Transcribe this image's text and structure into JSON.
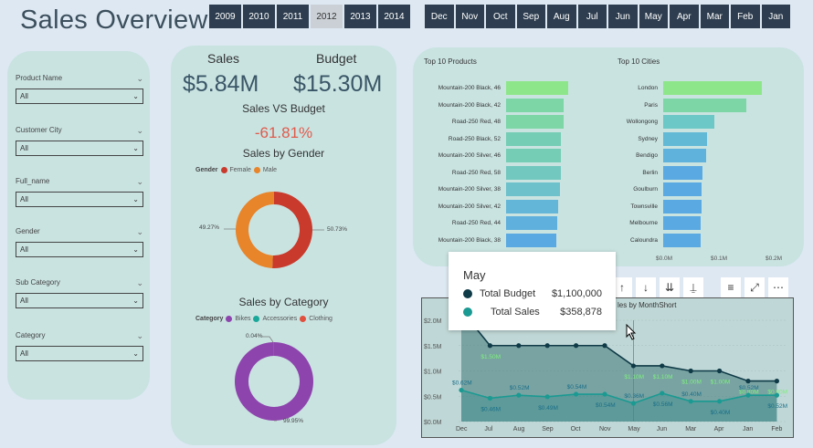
{
  "header": {
    "title": "Sales Overview"
  },
  "years": [
    "2009",
    "2010",
    "2011",
    "2012",
    "2013",
    "2014"
  ],
  "selected_year": "2012",
  "months": [
    "Dec",
    "Nov",
    "Oct",
    "Sep",
    "Aug",
    "Jul",
    "Jun",
    "May",
    "Apr",
    "Mar",
    "Feb",
    "Jan"
  ],
  "filters": [
    {
      "label": "Product Name",
      "value": "All"
    },
    {
      "label": "Customer City",
      "value": "All"
    },
    {
      "label": "Full_name",
      "value": "All"
    },
    {
      "label": "Gender",
      "value": "All"
    },
    {
      "label": "Sub Category",
      "value": "All"
    },
    {
      "label": "Category",
      "value": "All"
    }
  ],
  "kpi": {
    "sales_label": "Sales",
    "sales_value": "$5.84M",
    "budget_label": "Budget",
    "budget_value": "$15.30M",
    "svb_title": "Sales VS Budget",
    "variance": "-61.81%"
  },
  "gender_chart": {
    "title": "Sales by Gender",
    "legend_title": "Gender",
    "items": [
      {
        "name": "Female",
        "value": 50.73,
        "label": "50.73%",
        "color": "#c93a2c"
      },
      {
        "name": "Male",
        "value": 49.27,
        "label": "49.27%",
        "color": "#e8842a"
      }
    ]
  },
  "category_chart": {
    "title": "Sales by Category",
    "legend_title": "Category",
    "items": [
      {
        "name": "Bikes",
        "value": 99.95,
        "label": "99.95%",
        "color": "#8e44ad"
      },
      {
        "name": "Accessories",
        "value": 0.04,
        "label": "0.04%",
        "color": "#1aa89a"
      },
      {
        "name": "Clothing",
        "value": 0.01,
        "label": "",
        "color": "#e0503c"
      }
    ]
  },
  "top_products": {
    "title": "Top 10 Products",
    "items": [
      "Mountain-200 Black, 46",
      "Mountain-200 Black, 42",
      "Road-250 Red, 48",
      "Road-250 Black, 52",
      "Mountain-200 Silver, 46",
      "Road-250 Red, 58",
      "Mountain-200 Silver, 38",
      "Mountain-200 Silver, 42",
      "Road-250 Red, 44",
      "Mountain-200 Black, 38"
    ],
    "values": [
      0.22,
      0.205,
      0.203,
      0.195,
      0.195,
      0.193,
      0.192,
      0.183,
      0.18,
      0.178
    ],
    "colors": [
      "#8ee68a",
      "#7dd6a6",
      "#7dd6a6",
      "#74cdb4",
      "#74cdb4",
      "#72c8bf",
      "#6cc1cb",
      "#64b6d8",
      "#5fb0dd",
      "#5aa9e2"
    ]
  },
  "top_cities": {
    "title": "Top 10 Cities",
    "items": [
      "London",
      "Paris",
      "Wollongong",
      "Sydney",
      "Bendigo",
      "Berlin",
      "Goulburn",
      "Townsville",
      "Melbourne",
      "Caloundra"
    ],
    "values": [
      0.25,
      0.21,
      0.13,
      0.112,
      0.108,
      0.1,
      0.098,
      0.097,
      0.096,
      0.095
    ],
    "colors": [
      "#8ee68a",
      "#7dd6a6",
      "#6cc8c6",
      "#62b9d6",
      "#5eb2dc",
      "#5aa9e2",
      "#5aa9e2",
      "#5aa9e2",
      "#5aa9e2",
      "#5aa9e2"
    ],
    "axis_ticks": [
      "$0.0M",
      "$0.1M",
      "$0.2M"
    ]
  },
  "tooltip": {
    "title": "May",
    "rows": [
      {
        "label": "Total Budget",
        "value": "$1,100,000",
        "color": "#0f3a47"
      },
      {
        "label": "Total Sales",
        "value": "$358,878",
        "color": "#1a9a92"
      }
    ]
  },
  "toolbar_icons": [
    "arrow-up-icon",
    "arrow-down-icon",
    "double-down-icon",
    "expand-down-icon",
    "filter-icon",
    "focus-icon",
    "more-icon"
  ],
  "line_chart": {
    "title_fragment": "les by MonthShort",
    "chart_data": {
      "type": "line",
      "categories": [
        "Dec",
        "Jul",
        "Aug",
        "Sep",
        "Oct",
        "Nov",
        "May",
        "Jun",
        "Mar",
        "Apr",
        "Jan",
        "Feb"
      ],
      "series": [
        {
          "name": "Total Budget",
          "values": [
            2.2,
            1.5,
            1.5,
            1.5,
            1.5,
            1.5,
            1.1,
            1.1,
            1.0,
            1.0,
            0.8,
            0.8
          ],
          "color": "#0f3a47",
          "labels": [
            "",
            "$1.50M",
            "",
            "",
            "",
            "",
            "$1.10M",
            "$1.10M",
            "$1.00M",
            "$1.00M",
            "$0.80M",
            "$0.80M"
          ]
        },
        {
          "name": "Total Sales",
          "values": [
            0.62,
            0.46,
            0.52,
            0.49,
            0.54,
            0.54,
            0.36,
            0.56,
            0.4,
            0.4,
            0.52,
            0.52
          ],
          "color": "#1a9a92",
          "labels": [
            "$0.62M",
            "$0.46M",
            "$0.52M",
            "$0.49M",
            "$0.54M",
            "$0.54M",
            "$0.36M",
            "$0.56M",
            "$0.40M",
            "$0.40M",
            "$0.52M",
            "$0.52M"
          ]
        }
      ],
      "ylim": [
        0,
        2.0
      ],
      "y_ticks": [
        "$0.0M",
        "$0.5M",
        "$1.0M",
        "$1.5M",
        "$2.0M"
      ],
      "extra_labels": [
        "$1.50M",
        "$1.00M"
      ]
    }
  }
}
